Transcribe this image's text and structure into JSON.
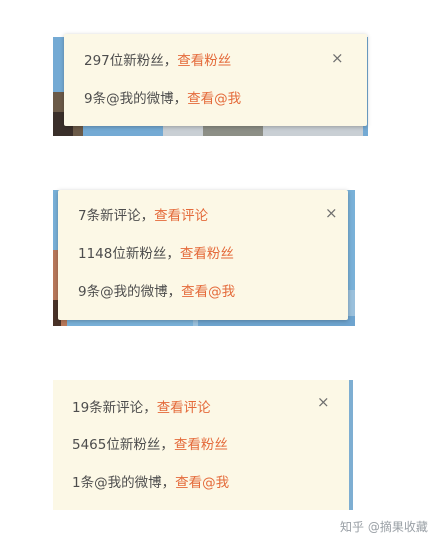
{
  "popups": [
    {
      "rows": [
        {
          "text": "297位新粉丝",
          "sep": "，",
          "link": "查看粉丝"
        },
        {
          "text": "9条@我的微博",
          "sep": "，",
          "link": "查看@我"
        }
      ],
      "close_glyph": "×"
    },
    {
      "rows": [
        {
          "text": "7条新评论",
          "sep": "，",
          "link": "查看评论"
        },
        {
          "text": "1148位新粉丝",
          "sep": "，",
          "link": "查看粉丝"
        },
        {
          "text": "9条@我的微博",
          "sep": "，",
          "link": "查看@我"
        }
      ],
      "close_glyph": "×"
    },
    {
      "rows": [
        {
          "text": "19条新评论",
          "sep": "，",
          "link": "查看评论"
        },
        {
          "text": "5465位新粉丝",
          "sep": "，",
          "link": "查看粉丝"
        },
        {
          "text": "1条@我的微博",
          "sep": "，",
          "link": "查看@我"
        }
      ],
      "close_glyph": "×"
    }
  ],
  "watermark": "知乎 @摘果收藏",
  "colors": {
    "card_bg": "#fcf8e6",
    "link": "#e46a3a",
    "text": "#4d4d4d",
    "page_bg": "#ffffff"
  }
}
